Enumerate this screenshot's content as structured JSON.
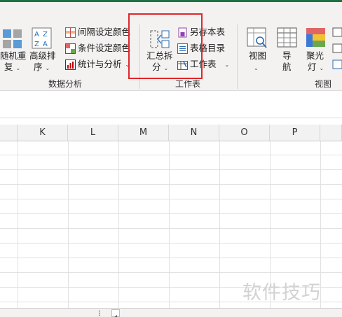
{
  "ribbon": {
    "data_analysis_group": {
      "random_sort": {
        "line1": "随机重",
        "line2": "复"
      },
      "advanced_sort": {
        "line1": "高级排",
        "line2": "序"
      },
      "interval_color": "间隔设定颜色",
      "conditional_color": "条件设定颜色",
      "stats_analysis": "统计与分析",
      "group_label": "数据分析"
    },
    "worksheet_group": {
      "summary_split": {
        "line1": "汇总拆",
        "line2": "分"
      },
      "save_copy": "另存本表",
      "sheet_directory": "表格目录",
      "worksheet": "工作表",
      "group_label": "工作表"
    },
    "view_group": {
      "view": "视图",
      "navigation": {
        "line1": "导",
        "line2": "航"
      },
      "spotlight": {
        "line1": "聚光",
        "line2": "灯"
      },
      "group_label": "视图"
    },
    "caret": "⌄"
  },
  "columns": [
    "K",
    "L",
    "M",
    "N",
    "O",
    "P"
  ],
  "watermark": "软件技巧",
  "colors": {
    "accent": "#1e7145",
    "highlight": "#e0262a"
  }
}
